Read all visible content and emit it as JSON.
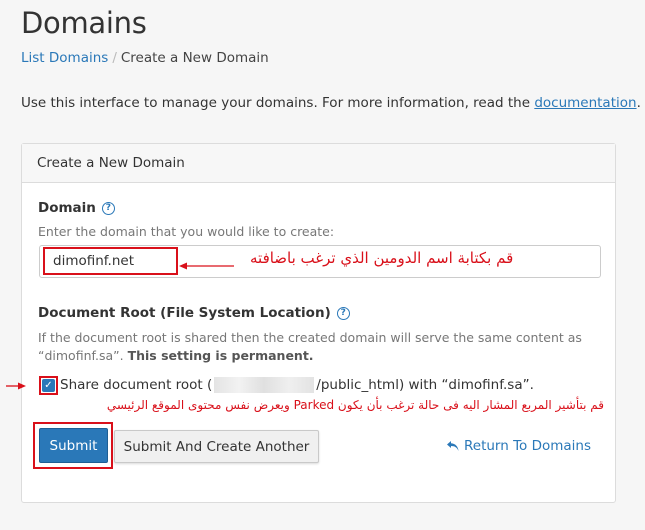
{
  "header": {
    "title": "Domains",
    "breadcrumb": {
      "parent": "List Domains",
      "separator": "/",
      "current": "Create a New Domain"
    },
    "intro_text": "Use this interface to manage your domains. For more information, read the",
    "intro_link": "documentation",
    "intro_end": "."
  },
  "panel": {
    "heading": "Create a New Domain",
    "domain": {
      "label": "Domain",
      "help_icon": "question-circle-icon",
      "hint": "Enter the domain that you would like to create:",
      "value": "dimofinf.net",
      "annotation": "قم بكتابة اسم الدومين الذي ترغب باضافته"
    },
    "docroot": {
      "label": "Document Root (File System Location)",
      "help_icon": "question-circle-icon",
      "hint_line1": "If the document root is shared then the created domain will serve the same content as",
      "hint_line2": "“dimofinf.sa”.",
      "hint_bold": "This setting is permanent.",
      "checkbox_checked": true,
      "checkbox_label_pre": "Share document root (",
      "checkbox_label_post": "/public_html) with “dimofinf.sa”.",
      "annotation": "قم بتأشير المربع المشار اليه فى حالة ترغب بأن يكون Parked ويعرض نفس محتوى الموقع الرئيسي"
    },
    "actions": {
      "submit": "Submit",
      "submit_another": "Submit And Create Another",
      "return_link": "Return To Domains",
      "return_icon": "undo-arrow-icon"
    }
  },
  "colors": {
    "accent": "#2a78b8",
    "annotation_red": "#d9101a"
  }
}
